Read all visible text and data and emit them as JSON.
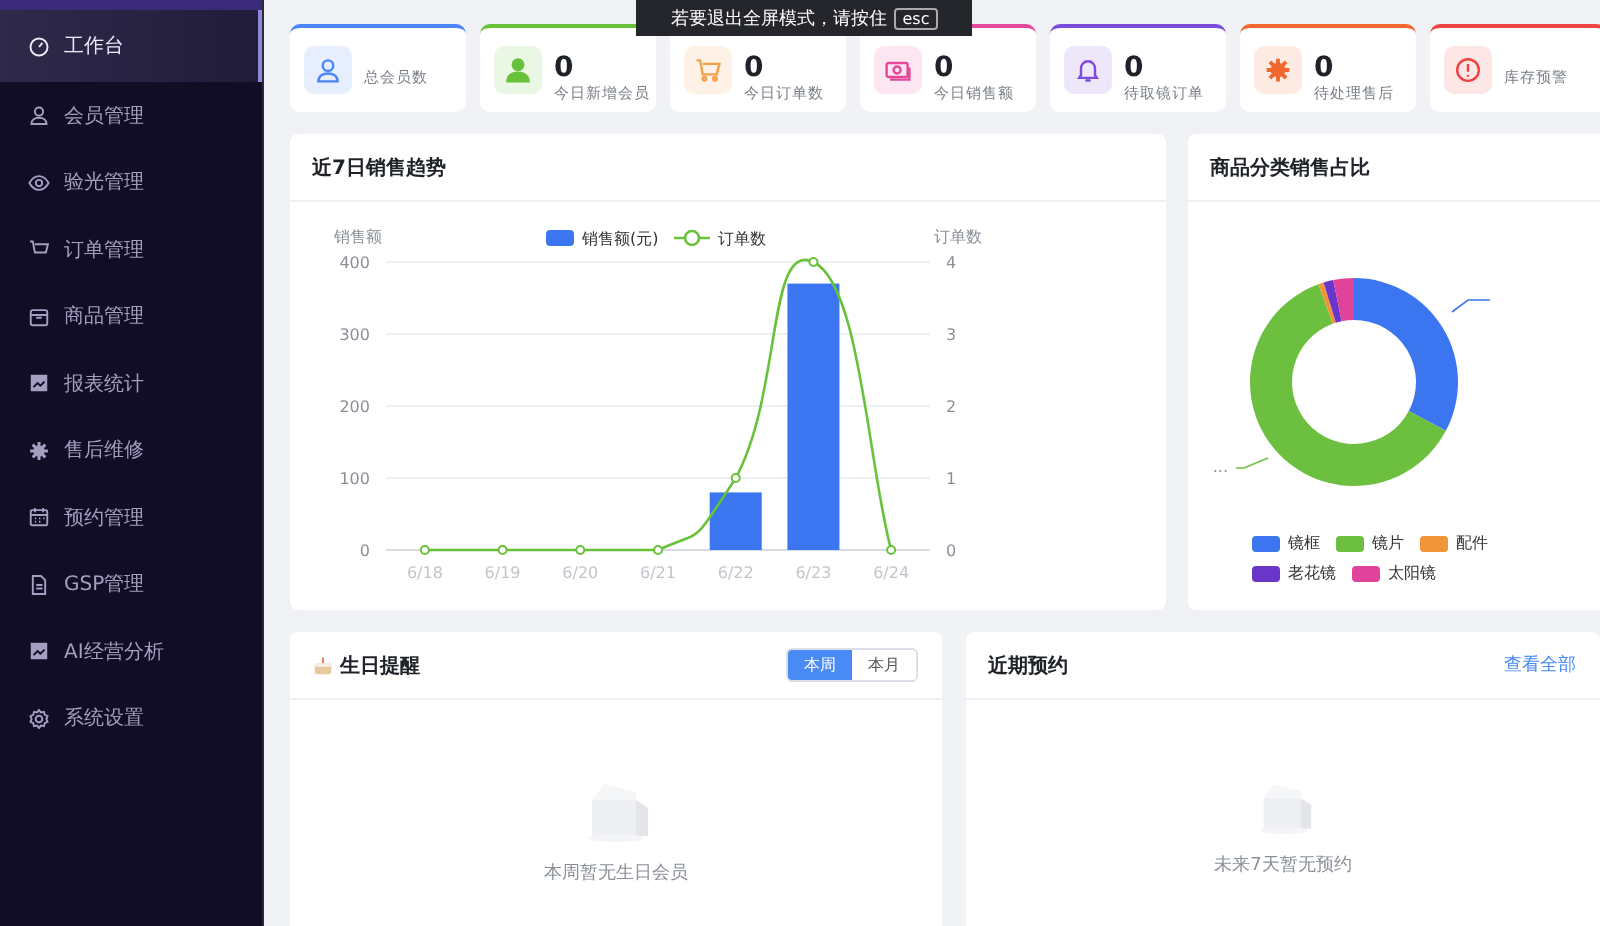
{
  "sidebar": {
    "items": [
      {
        "label": "工作台",
        "selected": true
      },
      {
        "label": "会员管理",
        "selected": false
      },
      {
        "label": "验光管理",
        "selected": false
      },
      {
        "label": "订单管理",
        "selected": false
      },
      {
        "label": "商品管理",
        "selected": false
      },
      {
        "label": "报表统计",
        "selected": false
      },
      {
        "label": "售后维修",
        "selected": false
      },
      {
        "label": "预约管理",
        "selected": false
      },
      {
        "label": "GSP管理",
        "selected": false
      },
      {
        "label": "AI经营分析",
        "selected": false
      },
      {
        "label": "系统设置",
        "selected": false
      }
    ]
  },
  "fullscreen_notice": {
    "text": "若要退出全屏模式，请按住",
    "key": "esc"
  },
  "stats": [
    {
      "label": "总会员数",
      "color": "#4a86f7"
    },
    {
      "value": "0",
      "label": "今日新增会员",
      "color": "#67c23a"
    },
    {
      "value": "0",
      "label": "今日订单数",
      "color": "#f5a04a"
    },
    {
      "value": "0",
      "label": "今日销售额",
      "color": "#e5479a"
    },
    {
      "value": "0",
      "label": "待取镜订单",
      "color": "#7c4ddb"
    },
    {
      "value": "0",
      "label": "待处理售后",
      "color": "#f2672e"
    },
    {
      "label": "库存预警",
      "color": "#ef4444"
    }
  ],
  "sales_trend": {
    "title": "近7日销售趋势",
    "chart_data": {
      "type": "bar",
      "categories": [
        "6/18",
        "6/19",
        "6/20",
        "6/21",
        "6/22",
        "6/23",
        "6/24"
      ],
      "series": [
        {
          "name": "销售额(元)",
          "color": "#3b76f0",
          "values": [
            0,
            0,
            0,
            0,
            80,
            370,
            0
          ]
        },
        {
          "name": "订单数",
          "color": "#67c23a",
          "values": [
            0,
            0,
            0,
            0,
            1,
            4,
            0
          ],
          "type": "line",
          "axis": "y2",
          "marker": "circle"
        }
      ],
      "grid": true,
      "legend": true,
      "ylabel": "销售额",
      "y2label": "订单数",
      "ylim": [
        0,
        400
      ],
      "yticks": [
        0,
        100,
        200,
        300,
        400
      ],
      "y2lim": [
        0,
        4
      ],
      "y2ticks": [
        0,
        1,
        2,
        3,
        4
      ]
    }
  },
  "category_share": {
    "title": "商品分类销售占比",
    "other_label": "...",
    "legend": [
      {
        "label": "镜框",
        "color": "#3b76f0"
      },
      {
        "label": "镜片",
        "color": "#6cbf3f"
      },
      {
        "label": "配件",
        "color": "#f0953a"
      },
      {
        "label": "老花镜",
        "color": "#6a35c9"
      },
      {
        "label": "太阳镜",
        "color": "#e0449a"
      }
    ]
  },
  "birthday": {
    "title": "生日提醒",
    "tabs": [
      {
        "label": "本周",
        "selected": true
      },
      {
        "label": "本月",
        "selected": false
      }
    ],
    "empty_text": "本周暂无生日会员"
  },
  "appointments": {
    "title": "近期预约",
    "link": "查看全部",
    "empty_text": "未来7天暂无预约"
  }
}
